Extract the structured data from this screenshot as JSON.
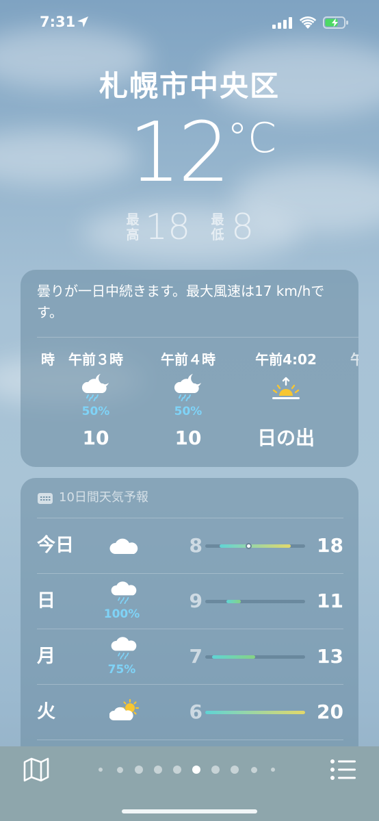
{
  "status_bar": {
    "time": "7:31"
  },
  "location": {
    "name": "札幌市中央区"
  },
  "current": {
    "temperature": "12",
    "unit": "°C",
    "high_label": "最高",
    "high": "18",
    "low_label": "最低",
    "low": "8"
  },
  "hourly": {
    "summary": "曇りが一日中続きます。最大風速は17 km/hです。",
    "items": [
      {
        "time": "時",
        "icon": "cloud-moon-rain-icon",
        "pop": "",
        "temp": ""
      },
      {
        "time": "午前３時",
        "icon": "cloud-moon-rain-icon",
        "pop": "50%",
        "temp": "10"
      },
      {
        "time": "午前４時",
        "icon": "cloud-moon-rain-icon",
        "pop": "50%",
        "temp": "10"
      },
      {
        "time": "午前4:02",
        "icon": "sunrise-icon",
        "pop": "",
        "temp": "日の出"
      },
      {
        "time": "午",
        "icon": "",
        "pop": "",
        "temp": ""
      }
    ]
  },
  "daily": {
    "header": "10日間天気予報",
    "range_min": 6,
    "range_max": 20,
    "days": [
      {
        "day": "今日",
        "icon": "cloud-icon",
        "pop": "",
        "low": "8",
        "high": "18",
        "low_val": 8,
        "high_val": 18,
        "current": 12
      },
      {
        "day": "日",
        "icon": "cloud-rain-icon",
        "pop": "100%",
        "low": "9",
        "high": "11",
        "low_val": 9,
        "high_val": 11
      },
      {
        "day": "月",
        "icon": "cloud-rain-icon",
        "pop": "75%",
        "low": "7",
        "high": "13",
        "low_val": 7,
        "high_val": 13
      },
      {
        "day": "火",
        "icon": "cloud-sun-icon",
        "pop": "",
        "low": "6",
        "high": "20",
        "low_val": 6,
        "high_val": 20
      }
    ]
  },
  "toolbar": {
    "page_count": 10,
    "active_page": 6
  },
  "colors": {
    "precipitation": "#7fd3f7",
    "bar_cool": "#5fd4d6",
    "bar_mild": "#86d383",
    "bar_warm": "#e3d86a",
    "sun": "#f7c631"
  }
}
